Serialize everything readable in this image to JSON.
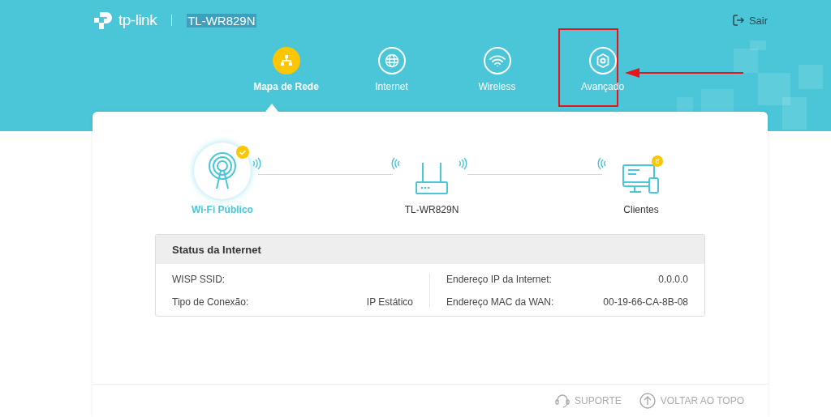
{
  "header": {
    "brand": "tp-link",
    "model": "TL-WR829N",
    "logout": "Sair"
  },
  "nav": [
    {
      "label": "Mapa de Rede",
      "selected": true,
      "highlighted": false
    },
    {
      "label": "Internet",
      "selected": false,
      "highlighted": false
    },
    {
      "label": "Wireless",
      "selected": false,
      "highlighted": false
    },
    {
      "label": "Avançado",
      "selected": false,
      "highlighted": true
    }
  ],
  "topology": [
    {
      "label": "Wi-Fi Público",
      "kind": "hotspot",
      "selected": true
    },
    {
      "label": "TL-WR829N",
      "kind": "router",
      "selected": false
    },
    {
      "label": "Clientes",
      "kind": "clients",
      "selected": false,
      "badge": "8"
    }
  ],
  "status": {
    "title": "Status da Internet",
    "left": [
      {
        "label": "WISP SSID:"
      },
      {
        "label": "Tipo de Conexão:",
        "value": "IP Estático"
      }
    ],
    "right": [
      {
        "label": "Endereço IP da Internet:",
        "value": "0.0.0.0"
      },
      {
        "label": "Endereço MAC da WAN:",
        "value": "00-19-66-CA-8B-08"
      }
    ]
  },
  "footer": [
    {
      "label": "SUPORTE"
    },
    {
      "label": "VOLTAR AO TOPO"
    }
  ]
}
